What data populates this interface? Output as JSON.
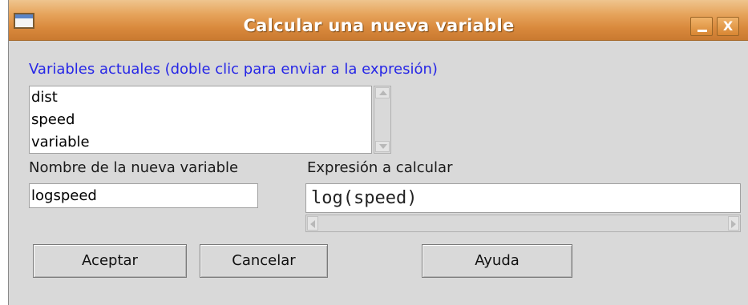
{
  "window": {
    "title": "Calcular una nueva variable",
    "minimize_label": "_",
    "close_label": "X"
  },
  "variables": {
    "label": "Variables actuales (doble clic para enviar a la expresión)",
    "items": [
      "dist",
      "speed",
      "variable"
    ]
  },
  "new_variable": {
    "label": "Nombre de la nueva variable",
    "value": "logspeed"
  },
  "expression": {
    "label": "Expresión a calcular",
    "value": "log(speed)"
  },
  "buttons": {
    "ok": "Aceptar",
    "cancel": "Cancelar",
    "help": "Ayuda"
  },
  "colors": {
    "titlebar": "#e6a45c",
    "label_blue": "#2626e6",
    "background": "#d9d9d9"
  }
}
